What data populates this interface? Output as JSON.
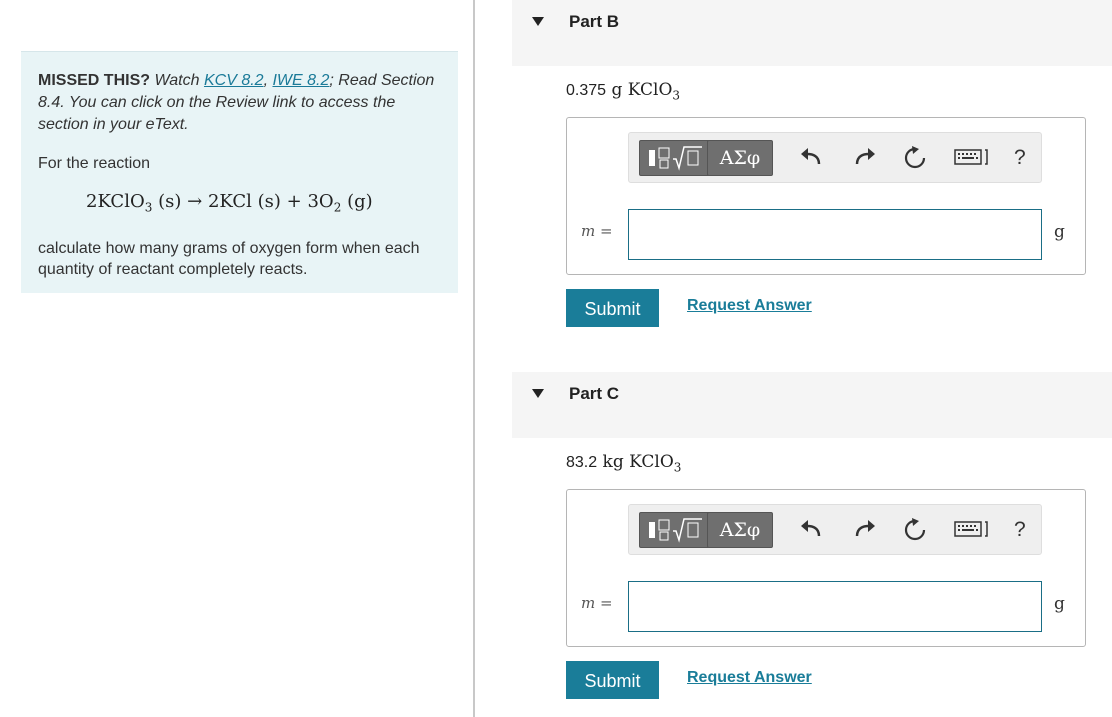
{
  "left": {
    "missed_label": "MISSED THIS?",
    "watch_text": "Watch",
    "link_kcv": "KCV 8.2",
    "link_iwe": "IWE 8.2",
    "read_text": "; Read Section 8.4. You can click on the Review link to access the section in your eText.",
    "for_reaction": "For the reaction",
    "equation": {
      "r1_coef": "2KClO",
      "r1_sub": "3",
      "r1_state": "(s)",
      "arrow": "→",
      "p1": "2KCl",
      "p1_state": "(s)",
      "plus": "+",
      "p2_coef": "3O",
      "p2_sub": "2",
      "p2_state": "(g)"
    },
    "calculate": "calculate how many grams of oxygen form when each quantity of reactant completely reacts."
  },
  "parts": [
    {
      "title": "Part B",
      "qty_num": "0.375",
      "qty_unit": "g",
      "qty_formula": "KClO",
      "qty_sub": "3",
      "var_label": "m =",
      "unit": "g",
      "submit": "Submit",
      "request": "Request Answer"
    },
    {
      "title": "Part C",
      "qty_num": "83.2",
      "qty_unit": "kg",
      "qty_formula": "KClO",
      "qty_sub": "3",
      "var_label": "m =",
      "unit": "g",
      "submit": "Submit",
      "request": "Request Answer"
    }
  ],
  "toolbar": {
    "greek_label": "ΑΣφ",
    "help_label": "?",
    "icons": [
      "templates-icon",
      "undo-icon",
      "redo-icon",
      "reset-icon",
      "keyboard-icon",
      "help-icon"
    ]
  }
}
